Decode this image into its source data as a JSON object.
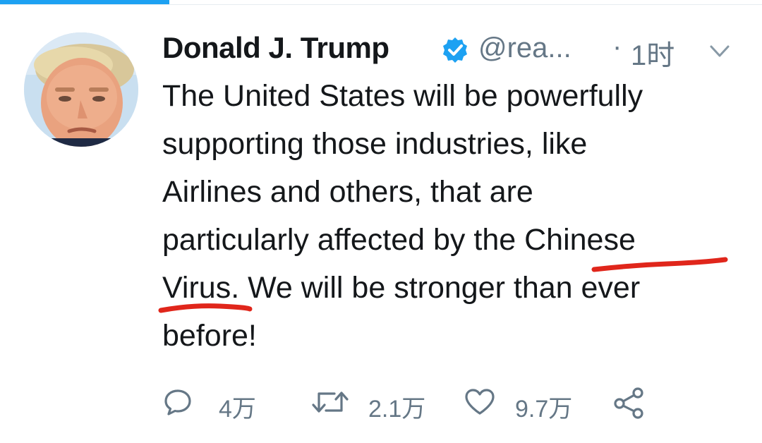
{
  "tweet": {
    "author_name": "Donald J. Trump",
    "handle": "@rea...",
    "separator": "·",
    "time": "1时",
    "body_lines": [
      "The United States will be powerfully",
      "supporting those industries, like",
      "Airlines and others, that are",
      "particularly affected by the Chinese",
      "Virus. We will be stronger than ever",
      "before!"
    ],
    "annotations": {
      "underlined_words": [
        "Chinese",
        "Virus"
      ],
      "underline_color": "#e0261b"
    }
  },
  "actions": {
    "reply_count": "4万",
    "retweet_count": "2.1万",
    "like_count": "9.7万"
  },
  "icons": {
    "verified": "verified-badge-icon",
    "more": "chevron-down-icon",
    "reply": "reply-bubble-icon",
    "retweet": "retweet-icon",
    "like": "heart-icon",
    "share": "share-icon"
  },
  "colors": {
    "brand_blue": "#1da1f2",
    "secondary_text": "#657786",
    "primary_text": "#14171a"
  }
}
